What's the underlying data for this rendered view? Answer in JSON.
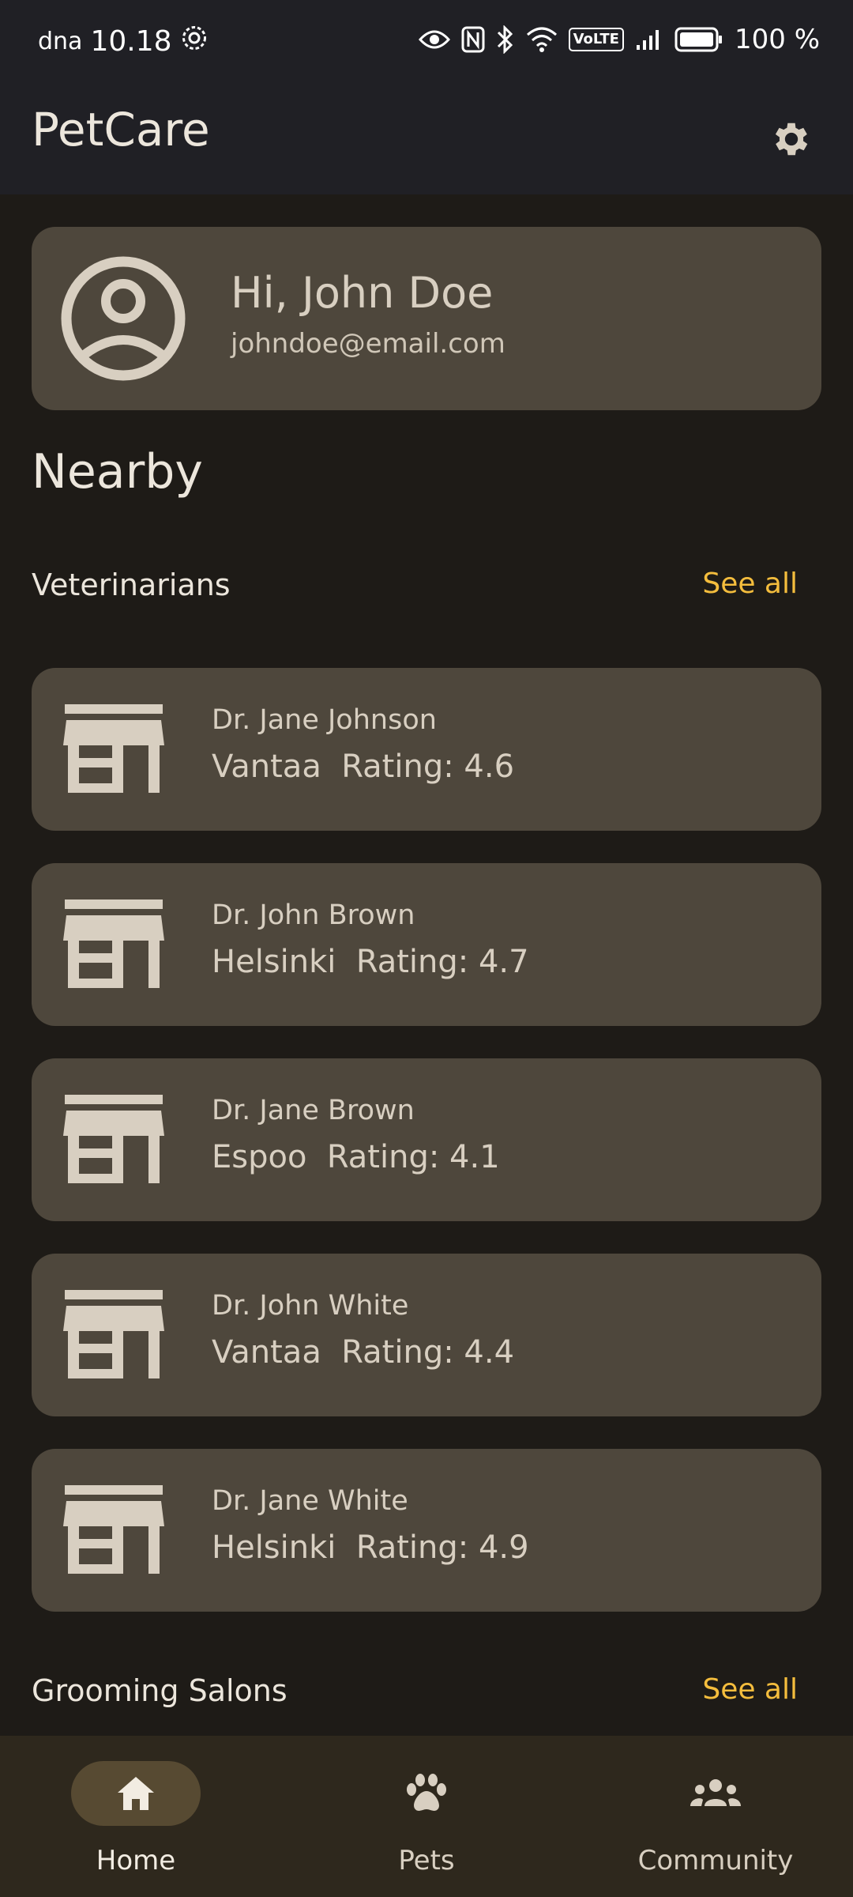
{
  "status_bar": {
    "carrier": "dna",
    "time": "10.18",
    "volte": "VoLTE",
    "battery": "100 %"
  },
  "app_bar": {
    "title": "PetCare"
  },
  "profile": {
    "greeting": "Hi, John Doe",
    "email": "johndoe@email.com"
  },
  "nearby": {
    "title": "Nearby",
    "veterinarians": {
      "title": "Veterinarians",
      "see_all": "See all",
      "items": [
        {
          "name": "Dr. Jane Johnson",
          "info": "Vantaa  Rating: 4.6"
        },
        {
          "name": "Dr. John Brown",
          "info": "Helsinki  Rating: 4.7"
        },
        {
          "name": "Dr. Jane Brown",
          "info": "Espoo  Rating: 4.1"
        },
        {
          "name": "Dr. John White",
          "info": "Vantaa  Rating: 4.4"
        },
        {
          "name": "Dr. Jane White",
          "info": "Helsinki  Rating: 4.9"
        }
      ]
    },
    "grooming": {
      "title": "Grooming Salons",
      "see_all": "See all"
    }
  },
  "bottom_nav": {
    "items": [
      {
        "label": "Home",
        "icon": "home-icon",
        "active": true
      },
      {
        "label": "Pets",
        "icon": "paw-icon",
        "active": false
      },
      {
        "label": "Community",
        "icon": "groups-icon",
        "active": false
      }
    ]
  },
  "colors": {
    "background": "#1e1b17",
    "card": "#4e473c",
    "accent": "#f4bd3d",
    "bar": "#202025",
    "nav": "#2e281d"
  }
}
